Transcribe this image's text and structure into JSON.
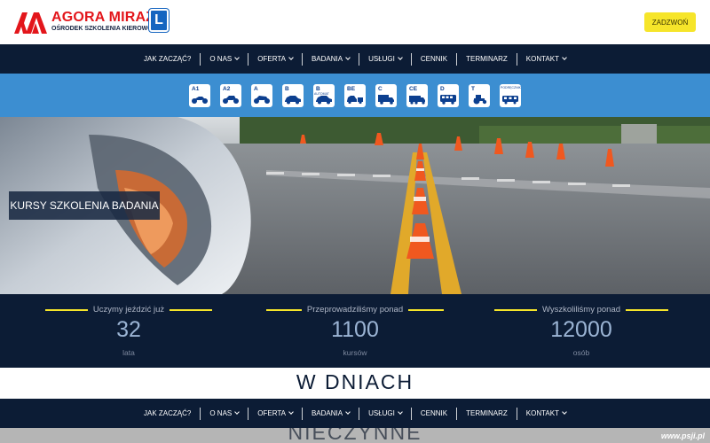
{
  "header": {
    "logo_title": "AGORA MIRAŻ",
    "logo_subtitle": "OŚRODEK SZKOLENIA KIEROWCÓW",
    "logo_badge": "L",
    "call_button": "ZADZWOŃ"
  },
  "nav": {
    "items": [
      {
        "label": "JAK ZACZĄĆ?",
        "dropdown": false
      },
      {
        "label": "O NAS",
        "dropdown": true
      },
      {
        "label": "OFERTA",
        "dropdown": true
      },
      {
        "label": "BADANIA",
        "dropdown": true
      },
      {
        "label": "USŁUGI",
        "dropdown": true
      },
      {
        "label": "CENNIK",
        "dropdown": false
      },
      {
        "label": "TERMINARZ",
        "dropdown": false
      },
      {
        "label": "KONTAKT",
        "dropdown": true
      }
    ]
  },
  "categories": [
    {
      "label": "A1",
      "sub": "",
      "icon": "motorcycle-icon"
    },
    {
      "label": "A2",
      "sub": "",
      "icon": "motorcycle-icon"
    },
    {
      "label": "A",
      "sub": "",
      "icon": "motorcycle-icon"
    },
    {
      "label": "B",
      "sub": "",
      "icon": "car-icon"
    },
    {
      "label": "B",
      "sub": "AUTOMAT",
      "icon": "car-icon"
    },
    {
      "label": "BE",
      "sub": "",
      "icon": "car-trailer-icon"
    },
    {
      "label": "C",
      "sub": "",
      "icon": "truck-icon"
    },
    {
      "label": "CE",
      "sub": "",
      "icon": "truck-trailer-icon"
    },
    {
      "label": "D",
      "sub": "",
      "icon": "bus-icon"
    },
    {
      "label": "T",
      "sub": "",
      "icon": "tractor-icon"
    },
    {
      "label": "",
      "sub": "PODRĘCZNIK",
      "icon": "tram-icon"
    }
  ],
  "hero": {
    "label": "KURSY SZKOLENIA BADANIA"
  },
  "stats": [
    {
      "label": "Uczymy jeździć już",
      "value": "32",
      "unit": "lata"
    },
    {
      "label": "Przeprowadziliśmy ponad",
      "value": "1100",
      "unit": "kursów"
    },
    {
      "label": "Wyszkoliliśmy ponad",
      "value": "12000",
      "unit": "osób"
    }
  ],
  "notice": {
    "line1": "W DNIACH",
    "line2": "NIECZYNNE"
  },
  "watermark": "www.psji.pl",
  "colors": {
    "brand_red": "#e3161b",
    "navy": "#0c1c35",
    "category_blue": "#3c8ed1",
    "accent_yellow": "#f6e52a"
  }
}
